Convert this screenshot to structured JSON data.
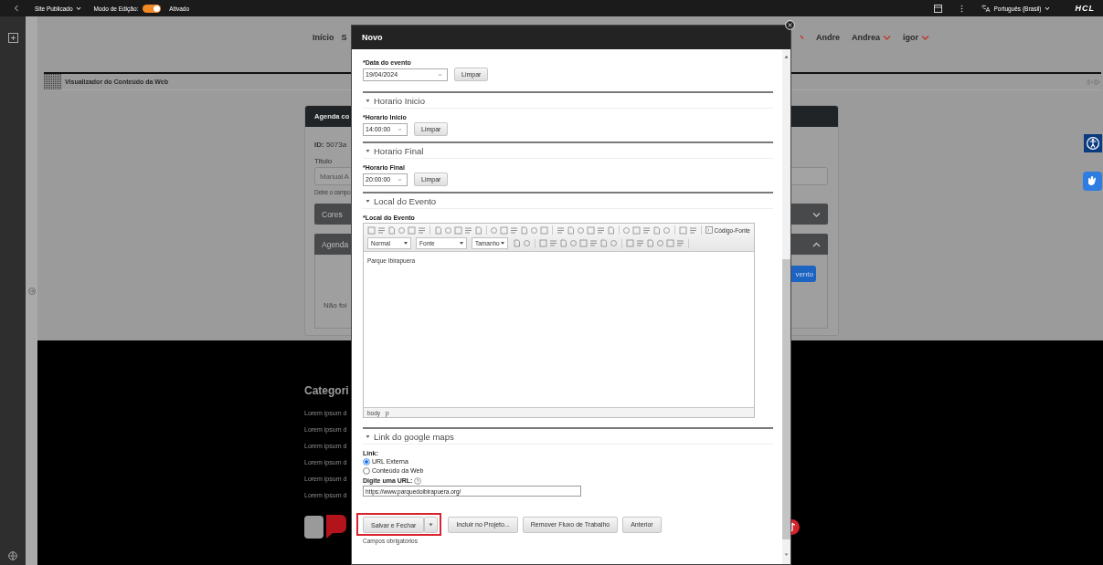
{
  "top_bar": {
    "site_menu": "Site Publicado",
    "edit_mode_label": "Modo de Edição:",
    "edit_mode_on": true,
    "edit_mode_status": "Ativado",
    "language": "Português (Brasil)",
    "brand": "HCL"
  },
  "nav": {
    "left": [
      {
        "label": "Início",
        "has_menu": false
      },
      {
        "label": "S",
        "has_menu": false
      }
    ],
    "right": [
      {
        "label": "Andre",
        "has_menu": false
      },
      {
        "label": "Andrea",
        "has_menu": true
      },
      {
        "label": "igor",
        "has_menu": true
      }
    ]
  },
  "portlet": {
    "title": "Visualizador do Conteúdo da Web"
  },
  "card": {
    "header": "Agenda co",
    "id_text": "**ID:** 5073a",
    "title_label": "Titulo",
    "title_value": "Manual A",
    "hint": "Deixe o campo",
    "sections": [
      {
        "label": "Cores",
        "expanded": false
      },
      {
        "label": "Agenda",
        "expanded": true
      }
    ],
    "button": "vento",
    "message": "Não foi"
  },
  "footer": {
    "heading": "Categori",
    "links": [
      "Lorem ipsum d",
      "Lorem ipsum d",
      "Lorem ipsum d",
      "Lorem ipsum d",
      "Lorem ipsum d",
      "Lorem ipsum d"
    ]
  },
  "dialog": {
    "title": "Novo",
    "date_field": {
      "label": "*Data do evento",
      "value": "19/04/2024",
      "clear": "Limpar"
    },
    "sections": [
      {
        "kind": "time",
        "title": "Horario Inicio",
        "expanded": true,
        "label": "*Horario Inicio",
        "value": "14:00:00",
        "clear": "Limpar"
      },
      {
        "kind": "time",
        "title": "Horario Final",
        "expanded": true,
        "label": "*Horario Final",
        "value": "20:00:00",
        "clear": "Limpar"
      },
      {
        "kind": "editor",
        "title": "Local do Evento",
        "expanded": true,
        "label": "*Local do Evento",
        "source_button": "Código-Fonte",
        "format": "Normal",
        "font": "Fonte",
        "size": "Tamanho",
        "content": "Parque Ibirapuera",
        "path": [
          "body",
          "p"
        ]
      },
      {
        "kind": "link",
        "title": "Link do google maps",
        "expanded": true,
        "label": "Link:",
        "options": [
          {
            "label": "URL Externa",
            "selected": true
          },
          {
            "label": "Conteúdo da Web",
            "selected": false
          }
        ],
        "url_label": "Digite uma URL:",
        "url": "https://www.parquedoibirapuera.org/"
      }
    ],
    "buttons": [
      {
        "label": "Salvar e Fechar",
        "has_menu": true,
        "highlighted": true
      },
      {
        "label": "Incluir no Projeto...",
        "has_menu": false,
        "highlighted": false
      },
      {
        "label": "Remover Fluxo de Trabalho",
        "has_menu": false,
        "highlighted": false
      },
      {
        "label": "Anterior",
        "has_menu": false,
        "highlighted": false
      }
    ],
    "footnote": "Campos obrigatórios"
  }
}
